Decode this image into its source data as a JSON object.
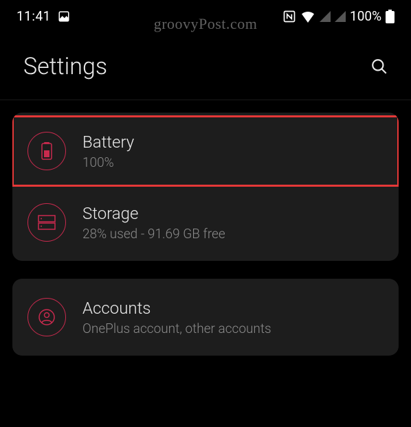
{
  "status": {
    "time": "11:41",
    "battery_pct": "100%"
  },
  "watermark": "groovyPost.com",
  "header": {
    "title": "Settings"
  },
  "groups": [
    {
      "items": [
        {
          "key": "battery",
          "title": "Battery",
          "subtitle": "100%",
          "highlighted": true
        },
        {
          "key": "storage",
          "title": "Storage",
          "subtitle": "28% used - 91.69 GB free",
          "highlighted": false
        }
      ]
    },
    {
      "items": [
        {
          "key": "accounts",
          "title": "Accounts",
          "subtitle": "OnePlus account, other accounts",
          "highlighted": false
        }
      ]
    }
  ]
}
